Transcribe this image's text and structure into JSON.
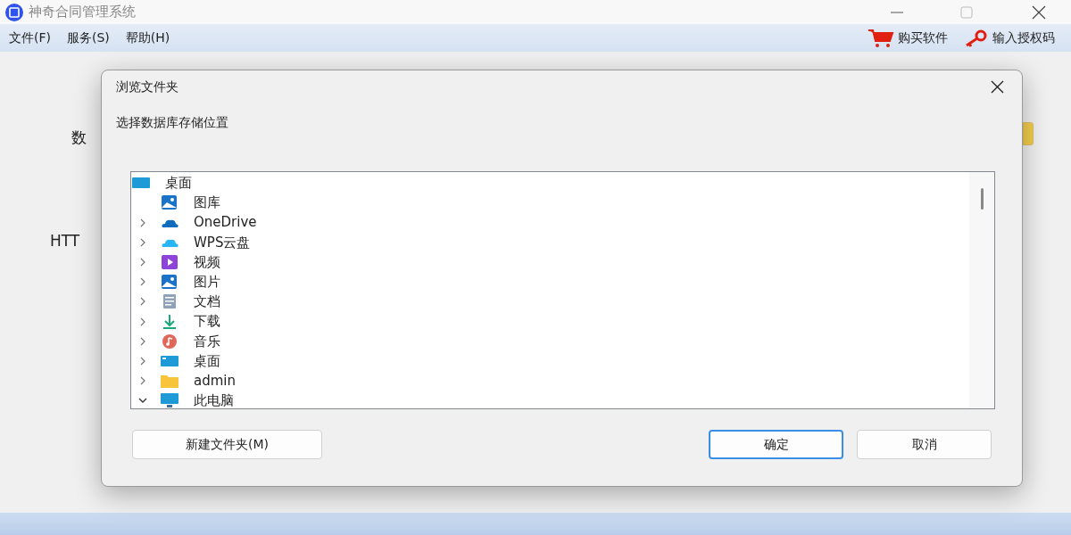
{
  "window": {
    "title": "神奇合同管理系统"
  },
  "menu": [
    "文件(F)",
    "服务(S)",
    "帮助(H)"
  ],
  "toolbar": [
    {
      "kind": "cart",
      "label": "购买软件"
    },
    {
      "kind": "key",
      "label": "输入授权码"
    }
  ],
  "background_labels": [
    "数",
    "HTT"
  ],
  "dialog": {
    "title": "浏览文件夹",
    "prompt": "选择数据库存储位置",
    "tree": {
      "label": "桌面",
      "kind": "desktop",
      "children": [
        {
          "label": "图库",
          "kind": "gallery"
        },
        {
          "label": "OneDrive",
          "kind": "cloud",
          "expanded": false
        },
        {
          "label": "WPS云盘",
          "kind": "cloud2",
          "expanded": false
        },
        {
          "label": "视频",
          "kind": "video",
          "expanded": false
        },
        {
          "label": "图片",
          "kind": "pictures",
          "expanded": false
        },
        {
          "label": "文档",
          "kind": "docs",
          "expanded": false
        },
        {
          "label": "下载",
          "kind": "download",
          "expanded": false
        },
        {
          "label": "音乐",
          "kind": "music",
          "expanded": false
        },
        {
          "label": "桌面",
          "kind": "desktop2",
          "expanded": false
        },
        {
          "label": "admin",
          "kind": "folder",
          "expanded": false
        },
        {
          "label": "此电脑",
          "kind": "pc",
          "expanded": true
        }
      ]
    },
    "new_folder_button": "新建文件夹(M)",
    "ok_button": "确定",
    "cancel_button": "取消"
  }
}
